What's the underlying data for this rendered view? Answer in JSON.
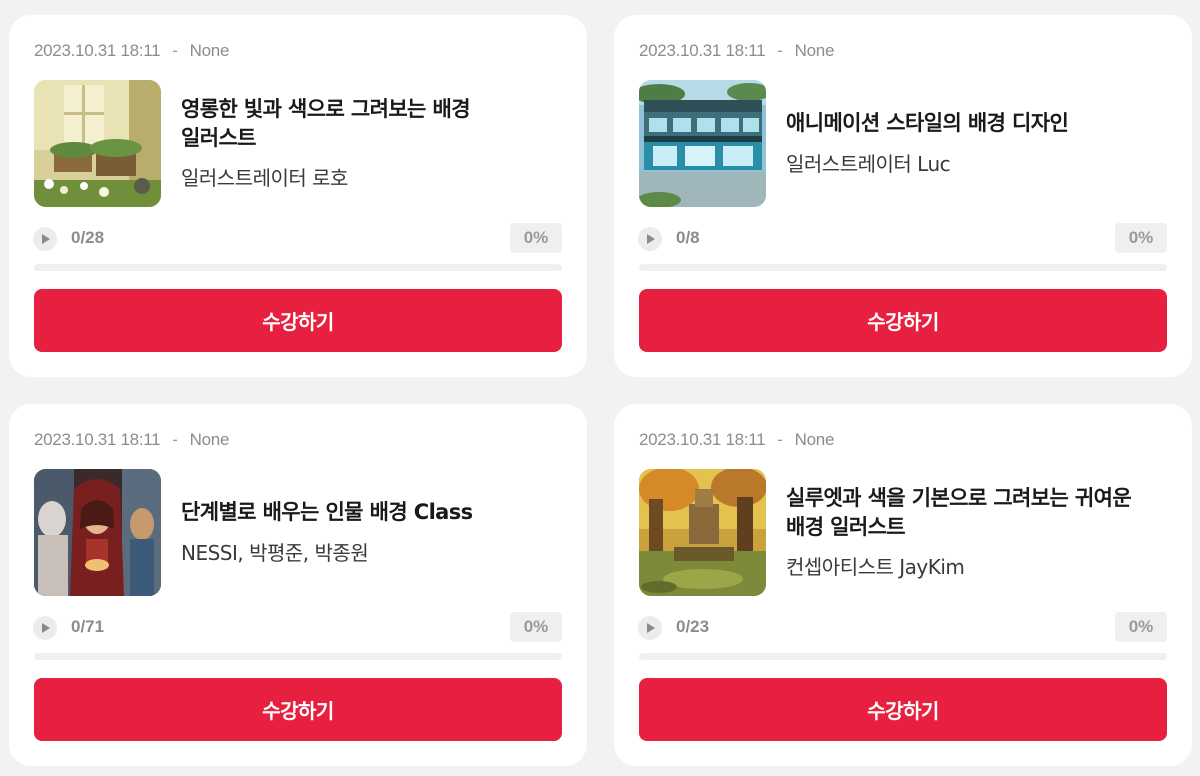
{
  "courses": [
    {
      "date": "2023.10.31 18:11",
      "separator": "-",
      "status": "None",
      "title_lines": [
        "영롱한 빛과 색으로 그려보는 배경",
        "일러스트"
      ],
      "author": "일러스트레이터 로호",
      "progress_count": "0/28",
      "progress_percent": "0%",
      "progress_fraction": 0,
      "button_label": "수강하기",
      "thumbnail_icon": "garden-illustration-thumbnail"
    },
    {
      "date": "2023.10.31 18:11",
      "separator": "-",
      "status": "None",
      "title_lines": [
        "애니메이션 스타일의 배경 디자인"
      ],
      "author": "일러스트레이터 Luc",
      "progress_count": "0/8",
      "progress_percent": "0%",
      "progress_fraction": 0,
      "button_label": "수강하기",
      "thumbnail_icon": "anime-building-thumbnail"
    },
    {
      "date": "2023.10.31 18:11",
      "separator": "-",
      "status": "None",
      "title_lines": [
        "단계별로 배우는 인물 배경 Class"
      ],
      "author": "NESSI, 박평준, 박종원",
      "progress_count": "0/71",
      "progress_percent": "0%",
      "progress_fraction": 0,
      "button_label": "수강하기",
      "thumbnail_icon": "character-illustration-thumbnail"
    },
    {
      "date": "2023.10.31 18:11",
      "separator": "-",
      "status": "None",
      "title_lines": [
        "실루엣과 색을 기본으로 그려보는 귀여운",
        "배경 일러스트"
      ],
      "author": "컨셉아티스트 JayKim",
      "progress_count": "0/23",
      "progress_percent": "0%",
      "progress_fraction": 0,
      "button_label": "수강하기",
      "thumbnail_icon": "forest-scene-thumbnail"
    }
  ],
  "colors": {
    "accent": "#e8203f",
    "background": "#f2f2f2",
    "card": "#ffffff"
  }
}
